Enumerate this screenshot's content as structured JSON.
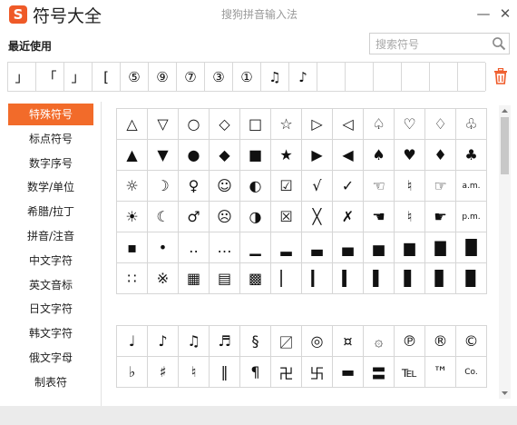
{
  "window": {
    "logo": "S",
    "title": "符号大全",
    "subtitle": "搜狗拼音输入法",
    "minimize": "—",
    "close": "✕"
  },
  "recent": {
    "label": "最近使用",
    "symbols": [
      "」",
      "「",
      "」",
      "[",
      "⑤",
      "⑨",
      "⑦",
      "③",
      "①",
      "♫",
      "♪",
      "",
      "",
      "",
      "",
      "",
      ""
    ]
  },
  "search": {
    "placeholder": "搜索符号",
    "value": ""
  },
  "sidebar": {
    "items": [
      {
        "label": "特殊符号",
        "active": true
      },
      {
        "label": "标点符号"
      },
      {
        "label": "数字序号"
      },
      {
        "label": "数学/单位"
      },
      {
        "label": "希腊/拉丁"
      },
      {
        "label": "拼音/注音"
      },
      {
        "label": "中文字符"
      },
      {
        "label": "英文音标"
      },
      {
        "label": "日文字符"
      },
      {
        "label": "韩文字符"
      },
      {
        "label": "俄文字母"
      },
      {
        "label": "制表符"
      }
    ]
  },
  "grids": [
    {
      "rows": [
        [
          "△",
          "▽",
          "○",
          "◇",
          "□",
          "☆",
          "▷",
          "◁",
          "♤",
          "♡",
          "♢",
          "♧"
        ],
        [
          "▲",
          "▼",
          "●",
          "◆",
          "■",
          "★",
          "▶",
          "◀",
          "♠",
          "♥",
          "♦",
          "♣"
        ],
        [
          "☼",
          "☽",
          "♀",
          "☺",
          "◐",
          "☑",
          "√",
          "✓",
          "☜",
          "♮",
          "☞",
          "a.m."
        ],
        [
          "☀",
          "☾",
          "♂",
          "☹",
          "◑",
          "☒",
          "╳",
          "✗",
          "☚",
          "♮",
          "☛",
          "p.m."
        ],
        [
          "▪",
          "•",
          "‥",
          "…",
          "▁",
          "▂",
          "▃",
          "▄",
          "▅",
          "▆",
          "▇",
          "█"
        ],
        [
          "∷",
          "※",
          "▦",
          "▤",
          "▩",
          "▏",
          "▎",
          "▍",
          "▌",
          "▋",
          "▊",
          "▉"
        ]
      ]
    },
    {
      "rows": [
        [
          "♩",
          "♪",
          "♫",
          "♬",
          "§",
          "〼",
          "◎",
          "¤",
          "۞",
          "℗",
          "®",
          "©"
        ],
        [
          "♭",
          "♯",
          "♮",
          "‖",
          "¶",
          "卍",
          "卐",
          "▬",
          "〓",
          "℡",
          "™",
          "Co."
        ]
      ]
    }
  ],
  "colors": {
    "accent": "#f26b2a",
    "brand": "#ef5a28"
  },
  "icons": {
    "search": "search-icon",
    "trash": "trash-icon"
  }
}
